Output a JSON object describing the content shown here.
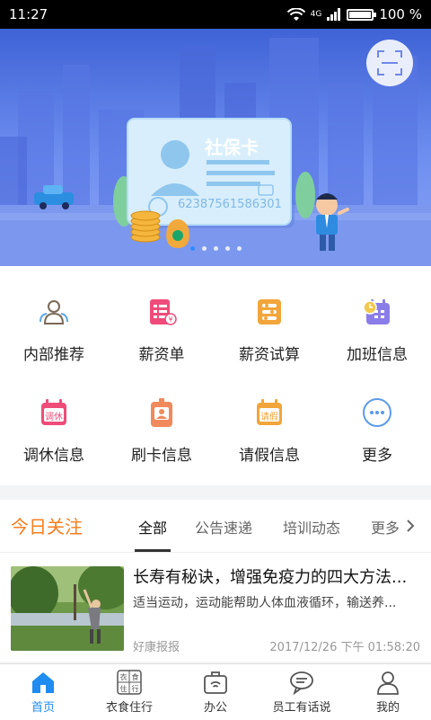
{
  "status": {
    "time": "11:27",
    "network": "4G",
    "battery": "100 %"
  },
  "banner": {
    "card_title": "社保卡",
    "card_number": "62387561586301",
    "slides": 5,
    "active_slide": 1
  },
  "menu": [
    {
      "label": "内部推荐",
      "icon": "people-icon"
    },
    {
      "label": "薪资单",
      "icon": "payslip-icon"
    },
    {
      "label": "薪资试算",
      "icon": "abacus-icon"
    },
    {
      "label": "加班信息",
      "icon": "overtime-calendar-icon"
    },
    {
      "label": "调休信息",
      "icon": "leave-swap-calendar-icon",
      "badge": "调休"
    },
    {
      "label": "刷卡信息",
      "icon": "badge-card-icon"
    },
    {
      "label": "请假信息",
      "icon": "leave-calendar-icon",
      "badge": "请假"
    },
    {
      "label": "更多",
      "icon": "more-icon"
    }
  ],
  "today": {
    "title": "今日关注",
    "tabs": [
      "全部",
      "公告速递",
      "培训动态",
      "更多"
    ],
    "active_tab": 0,
    "article": {
      "title": "长寿有秘诀，增强免疫力的四大方法...",
      "summary": "适当运动，运动能帮助人体血液循环，输送养...",
      "source": "好康报报",
      "time": "2017/12/26 下午 01:58:20"
    }
  },
  "nav": [
    {
      "label": "首页",
      "icon": "home-icon",
      "active": true
    },
    {
      "label": "衣食住行",
      "icon": "lifestyle-icon",
      "active": false
    },
    {
      "label": "办公",
      "icon": "office-bag-icon",
      "active": false
    },
    {
      "label": "员工有话说",
      "icon": "chat-bubble-icon",
      "active": false
    },
    {
      "label": "我的",
      "icon": "profile-icon",
      "active": false
    }
  ],
  "colors": {
    "accent_blue": "#1e8cf0",
    "accent_orange": "#f57e1f"
  }
}
